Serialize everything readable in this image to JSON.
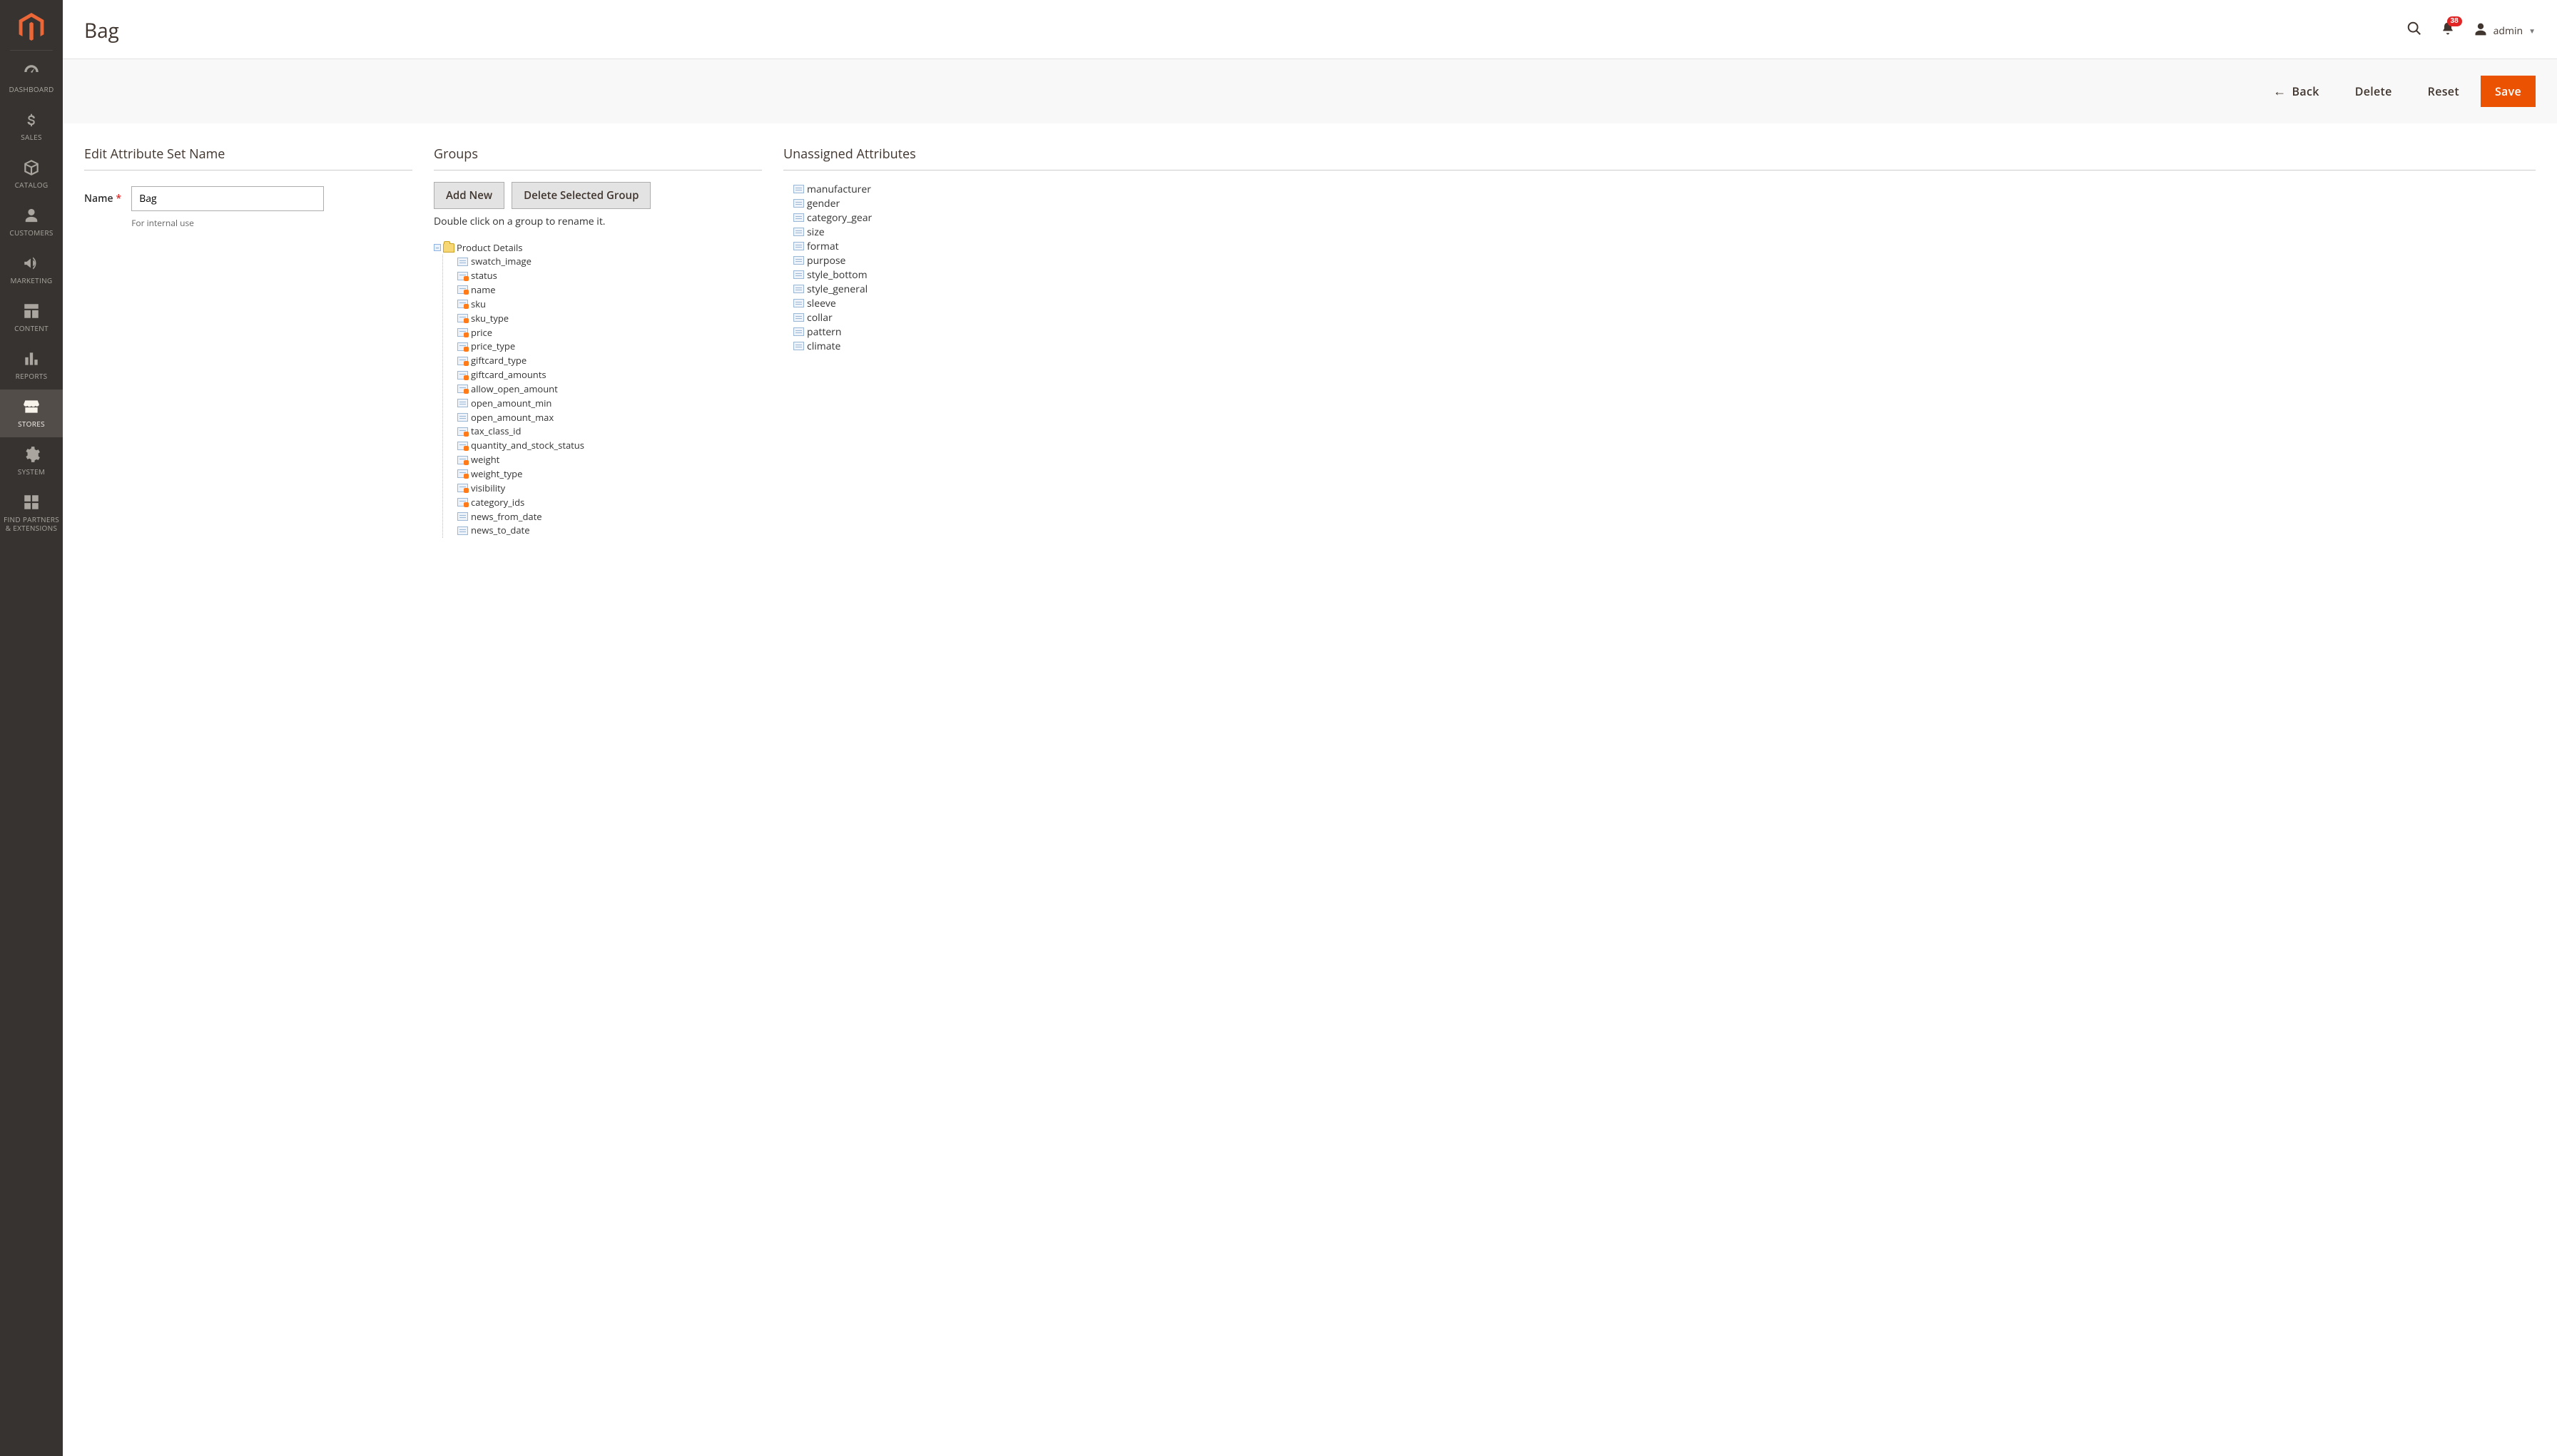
{
  "sidebar": {
    "items": [
      {
        "label": "DASHBOARD",
        "icon": "gauge"
      },
      {
        "label": "SALES",
        "icon": "dollar"
      },
      {
        "label": "CATALOG",
        "icon": "box"
      },
      {
        "label": "CUSTOMERS",
        "icon": "person"
      },
      {
        "label": "MARKETING",
        "icon": "megaphone"
      },
      {
        "label": "CONTENT",
        "icon": "layout"
      },
      {
        "label": "REPORTS",
        "icon": "bars"
      },
      {
        "label": "STORES",
        "icon": "storefront",
        "active": true
      },
      {
        "label": "SYSTEM",
        "icon": "gear"
      },
      {
        "label": "FIND PARTNERS & EXTENSIONS",
        "icon": "blocks"
      }
    ]
  },
  "header": {
    "title": "Bag",
    "notification_count": "38",
    "username": "admin"
  },
  "toolbar": {
    "back": "Back",
    "delete": "Delete",
    "reset": "Reset",
    "save": "Save"
  },
  "edit_name": {
    "section_title": "Edit Attribute Set Name",
    "label": "Name",
    "value": "Bag",
    "note": "For internal use"
  },
  "groups": {
    "section_title": "Groups",
    "add_new": "Add New",
    "delete_group": "Delete Selected Group",
    "hint": "Double click on a group to rename it.",
    "root": "Product Details",
    "children": [
      {
        "name": "swatch_image",
        "locked": false
      },
      {
        "name": "status",
        "locked": true
      },
      {
        "name": "name",
        "locked": true
      },
      {
        "name": "sku",
        "locked": true
      },
      {
        "name": "sku_type",
        "locked": true
      },
      {
        "name": "price",
        "locked": true
      },
      {
        "name": "price_type",
        "locked": true
      },
      {
        "name": "giftcard_type",
        "locked": true
      },
      {
        "name": "giftcard_amounts",
        "locked": true
      },
      {
        "name": "allow_open_amount",
        "locked": true
      },
      {
        "name": "open_amount_min",
        "locked": false
      },
      {
        "name": "open_amount_max",
        "locked": false
      },
      {
        "name": "tax_class_id",
        "locked": true
      },
      {
        "name": "quantity_and_stock_status",
        "locked": true
      },
      {
        "name": "weight",
        "locked": true
      },
      {
        "name": "weight_type",
        "locked": true
      },
      {
        "name": "visibility",
        "locked": true
      },
      {
        "name": "category_ids",
        "locked": true
      },
      {
        "name": "news_from_date",
        "locked": false
      },
      {
        "name": "news_to_date",
        "locked": false
      }
    ]
  },
  "unassigned": {
    "section_title": "Unassigned Attributes",
    "items": [
      "manufacturer",
      "gender",
      "category_gear",
      "size",
      "format",
      "purpose",
      "style_bottom",
      "style_general",
      "sleeve",
      "collar",
      "pattern",
      "climate"
    ]
  }
}
